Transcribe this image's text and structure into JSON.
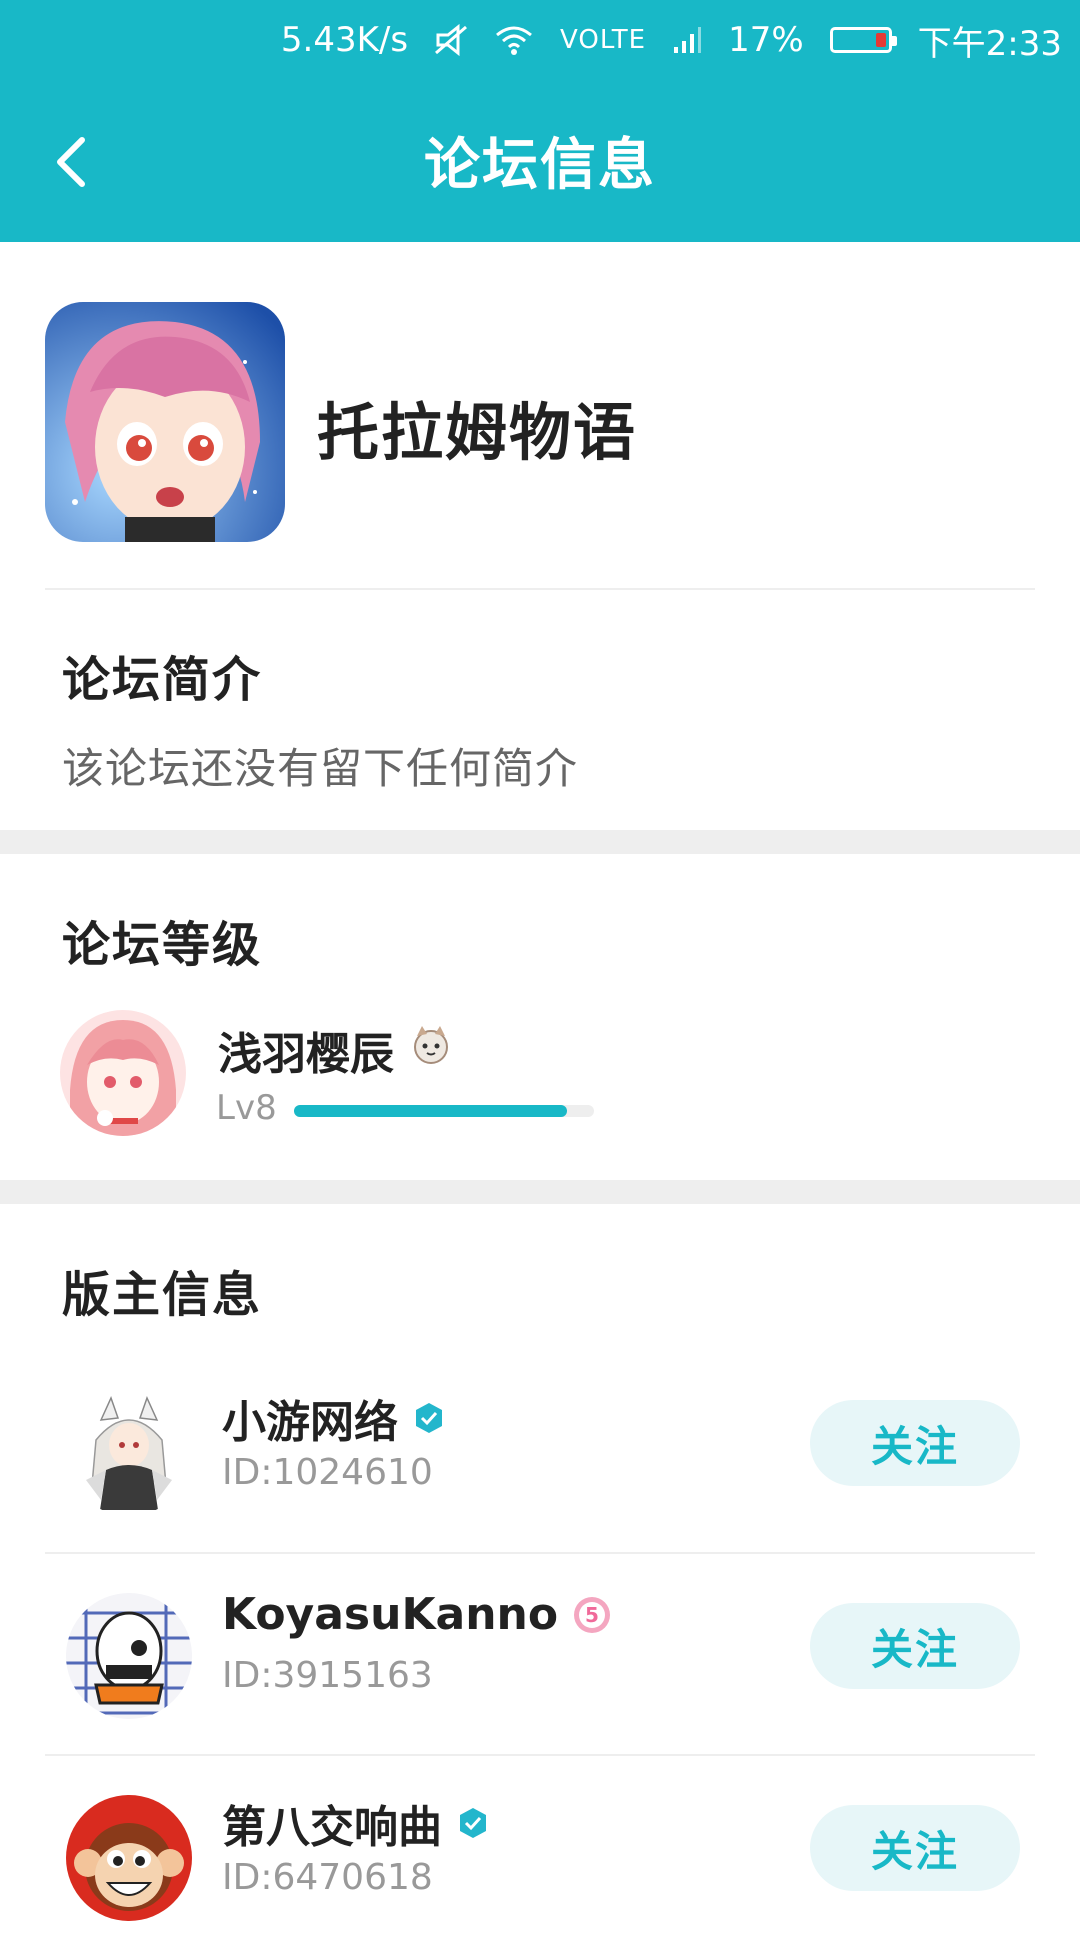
{
  "status_bar": {
    "net_speed": "5.43K/s",
    "volte": "VOLTE",
    "battery": "17%",
    "time": "下午2:33"
  },
  "app_bar": {
    "title": "论坛信息"
  },
  "forum": {
    "name": "托拉姆物语",
    "intro_title": "论坛简介",
    "intro_text": "该论坛还没有留下任何简介"
  },
  "level_section": {
    "title": "论坛等级",
    "user_name": "浅羽樱辰",
    "level": "Lv8",
    "progress": 0.91
  },
  "moderators": {
    "title": "版主信息",
    "items": [
      {
        "name": "小游网络",
        "id": "ID:1024610",
        "badge": "verified-badge-icon",
        "follow": "关注"
      },
      {
        "name": "KoyasuKanno",
        "id": "ID:3915163",
        "badge": "level-5-badge-icon",
        "follow": "关注"
      },
      {
        "name": "第八交响曲",
        "id": "ID:6470618",
        "badge": "verified-badge-icon",
        "follow": "关注"
      }
    ]
  },
  "colors": {
    "primary": "#18b8c7",
    "follow_bg": "#e7f6f8",
    "band": "#eeeeee"
  }
}
